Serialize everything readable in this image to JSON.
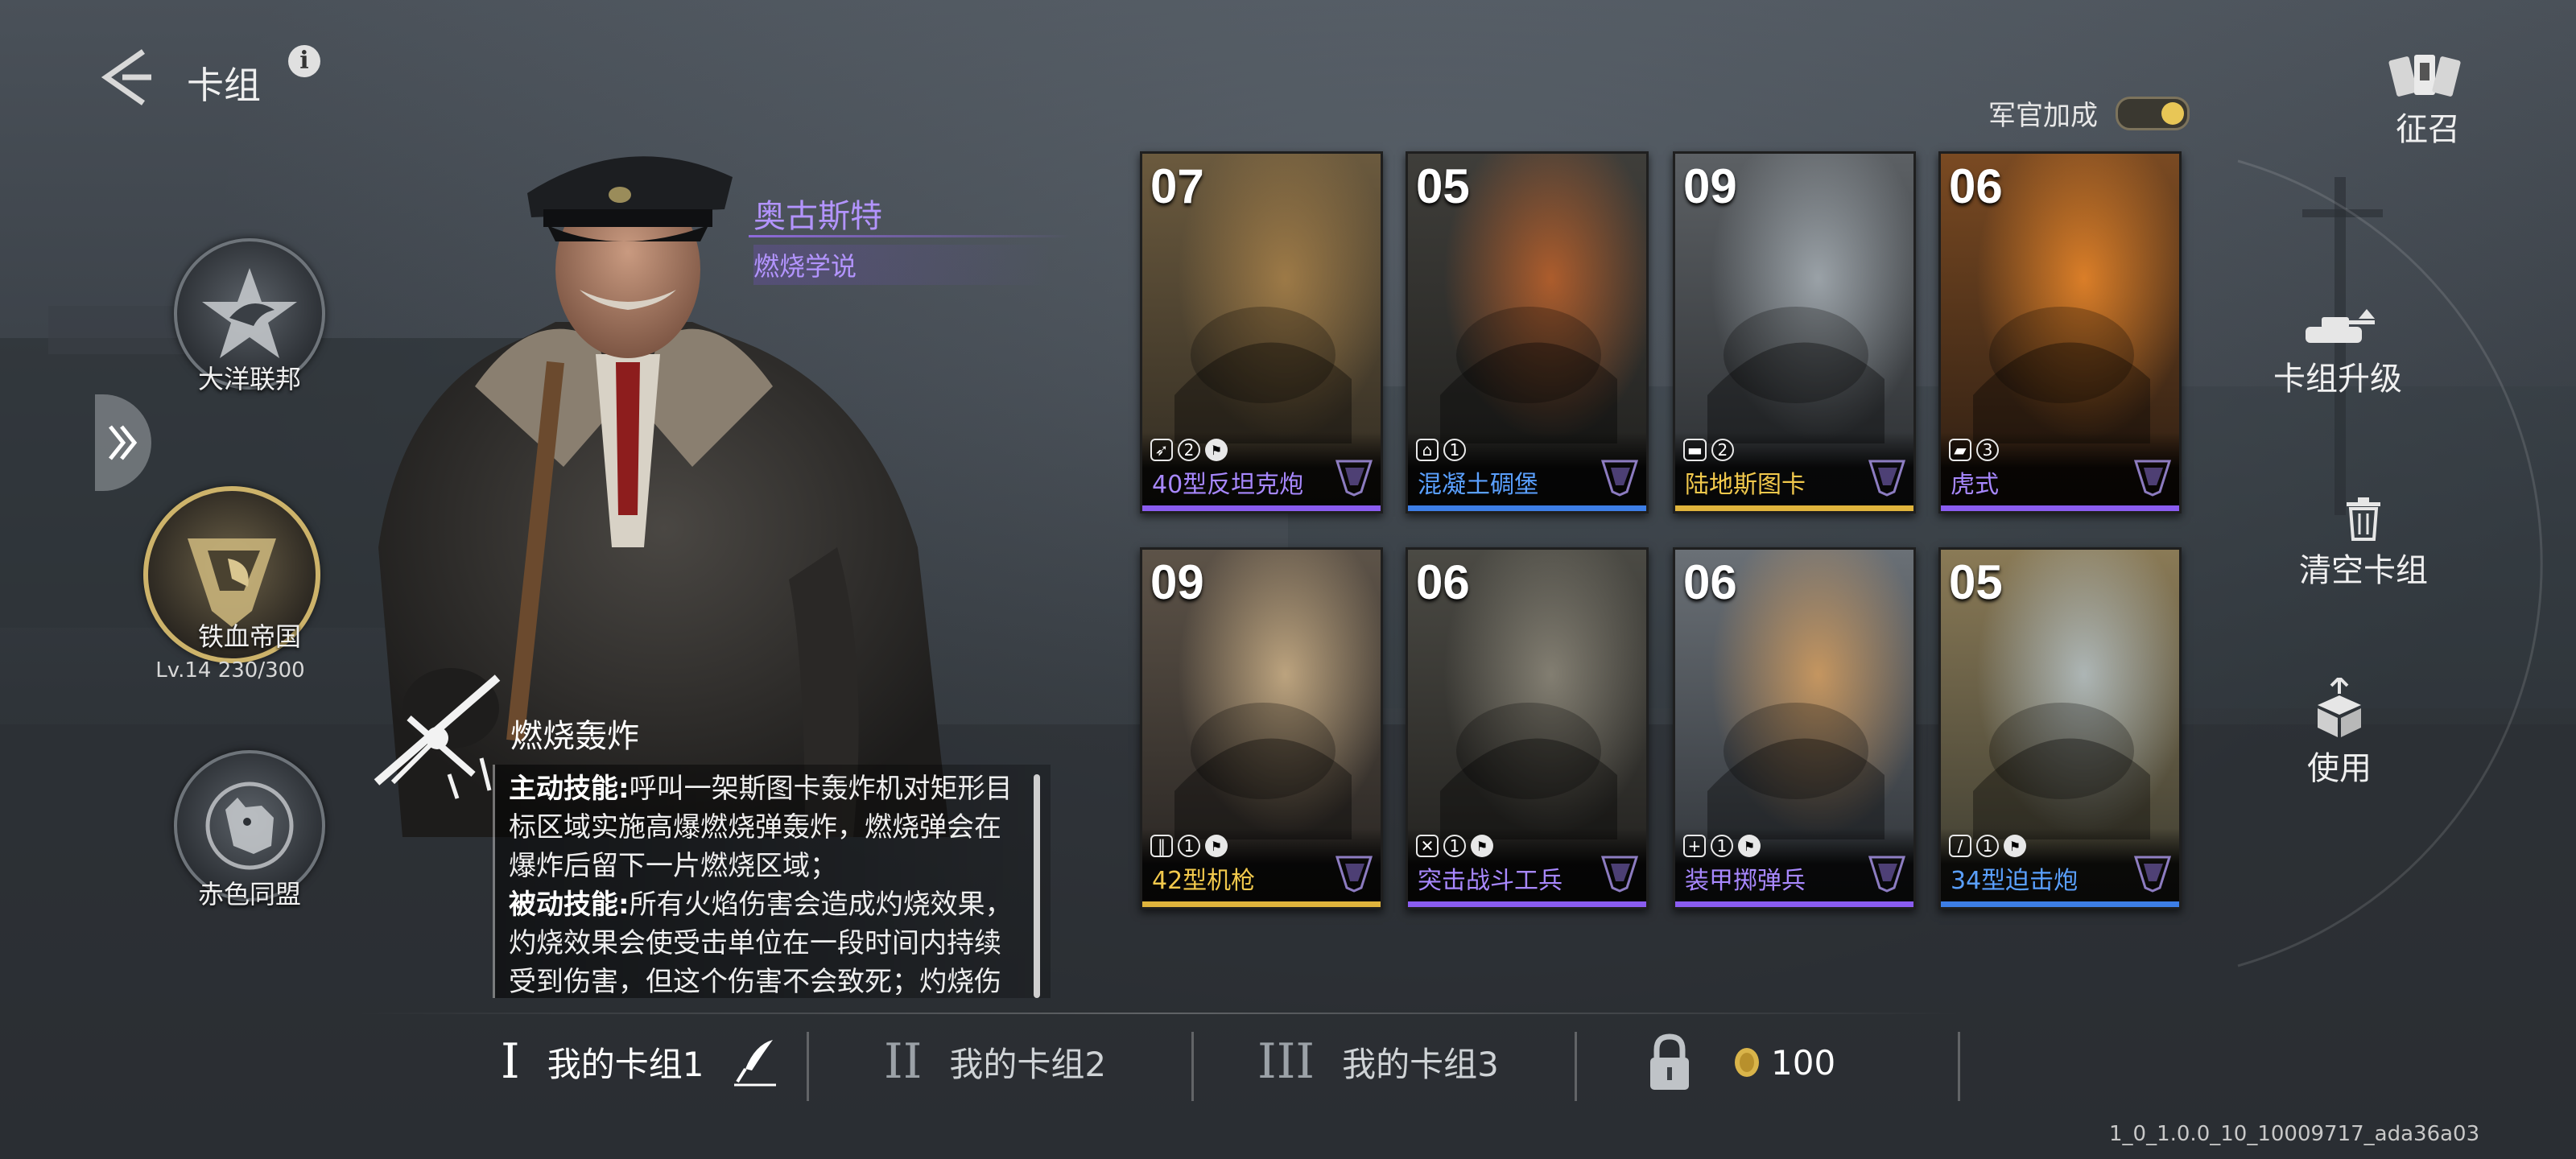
{
  "header": {
    "title": "卡组",
    "back_icon": "back-arrow-icon",
    "info_icon": "info-icon",
    "info_glyph": "i"
  },
  "factions": [
    {
      "name": "大洋联邦",
      "icon": "star-eagle-icon",
      "active": false
    },
    {
      "name": "铁血帝国",
      "icon": "lion-emblem-icon",
      "active": true,
      "level": "Lv.14  230/300"
    },
    {
      "name": "赤色同盟",
      "icon": "bear-emblem-icon",
      "active": false
    }
  ],
  "commander": {
    "name": "奥古斯特",
    "doctrine": "燃烧学说"
  },
  "skill": {
    "title": "燃烧轰炸",
    "active_label": "主动技能:",
    "active_text": "呼叫一架斯图卡轰炸机对矩形目标区域实施高爆燃烧弹轰炸，燃烧弹会在爆炸后留下一片燃烧区域；",
    "passive_label": "被动技能:",
    "passive_text": "所有火焰伤害会造成灼烧效果，灼烧效果会使受击单位在一段时间内持续受到伤害，但这个伤害不会致死；灼烧伤害对建筑有额外伤害。"
  },
  "officer_bonus": {
    "label": "军官加成",
    "enabled": true,
    "accent": "#e8c656"
  },
  "recruit": {
    "label": "征召",
    "icon": "cards-recruit-icon"
  },
  "cards": [
    {
      "cost": "07",
      "name": "40型反坦克炮",
      "stats": [
        "gun",
        "2",
        "flag"
      ],
      "rarity_color": "#8a5cf0",
      "name_color": "#a888ff"
    },
    {
      "cost": "05",
      "name": "混凝土碉堡",
      "stats": [
        "bunker",
        "1"
      ],
      "rarity_color": "#3d7ee6",
      "name_color": "#5aa0ff"
    },
    {
      "cost": "09",
      "name": "陆地斯图卡",
      "stats": [
        "vehicle",
        "2"
      ],
      "rarity_color": "#e0b43c",
      "name_color": "#f2c94c"
    },
    {
      "cost": "06",
      "name": "虎式",
      "stats": [
        "tank",
        "3"
      ],
      "rarity_color": "#8a5cf0",
      "name_color": "#a888ff"
    },
    {
      "cost": "09",
      "name": "42型机枪",
      "stats": [
        "ammo",
        "1",
        "flag"
      ],
      "rarity_color": "#e0b43c",
      "name_color": "#f2c94c"
    },
    {
      "cost": "06",
      "name": "突击战斗工兵",
      "stats": [
        "tools",
        "1",
        "flag"
      ],
      "rarity_color": "#8a5cf0",
      "name_color": "#a888ff"
    },
    {
      "cost": "06",
      "name": "装甲掷弹兵",
      "stats": [
        "medic",
        "1",
        "flag"
      ],
      "rarity_color": "#8a5cf0",
      "name_color": "#a888ff"
    },
    {
      "cost": "05",
      "name": "34型迫击炮",
      "stats": [
        "mortar",
        "1",
        "flag"
      ],
      "rarity_color": "#3d7ee6",
      "name_color": "#5aa0ff"
    }
  ],
  "actions": [
    {
      "label": "卡组升级",
      "icon": "tank-upgrade-icon"
    },
    {
      "label": "清空卡组",
      "icon": "trash-icon"
    },
    {
      "label": "使用",
      "icon": "box-use-icon"
    }
  ],
  "decks": [
    {
      "numeral": "I",
      "label": "我的卡组1",
      "active": true,
      "icon": "quill-edit-icon"
    },
    {
      "numeral": "II",
      "label": "我的卡组2",
      "active": false
    },
    {
      "numeral": "III",
      "label": "我的卡组3",
      "active": false
    }
  ],
  "locked_slot": {
    "icon": "padlock-icon",
    "coin_icon": "gold-coin-icon",
    "price": "100"
  },
  "version": "1_0_1.0.0_10_10009717_ada36a03"
}
